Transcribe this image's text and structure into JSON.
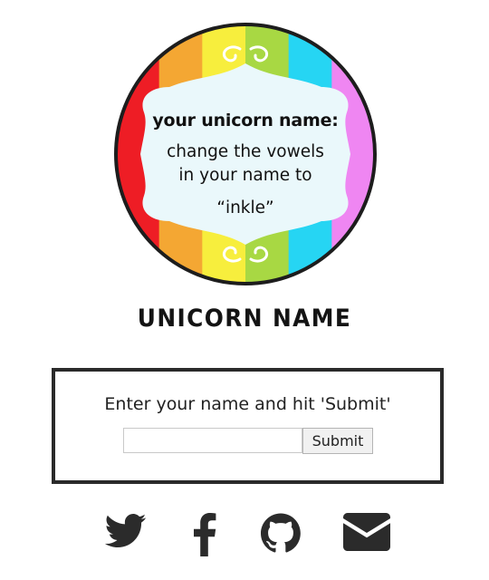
{
  "badge": {
    "heading": "your unicorn name:",
    "line1": "change the vowels",
    "line2": "in your name to",
    "line3": "“inkle”",
    "stripe_colors": [
      "#ee1d25",
      "#f4a733",
      "#f7ee3d",
      "#a8d843",
      "#26d5f3",
      "#ef86f2"
    ],
    "panel_color": "#eaf8fb",
    "border_color": "#1d1d1d"
  },
  "page": {
    "title": "UNICORN NAME"
  },
  "form": {
    "prompt": "Enter your name and hit 'Submit'",
    "name_value": "",
    "name_placeholder": "",
    "submit_label": "Submit"
  },
  "social": [
    {
      "icon": "twitter-icon"
    },
    {
      "icon": "facebook-icon"
    },
    {
      "icon": "github-icon"
    },
    {
      "icon": "email-icon"
    }
  ]
}
